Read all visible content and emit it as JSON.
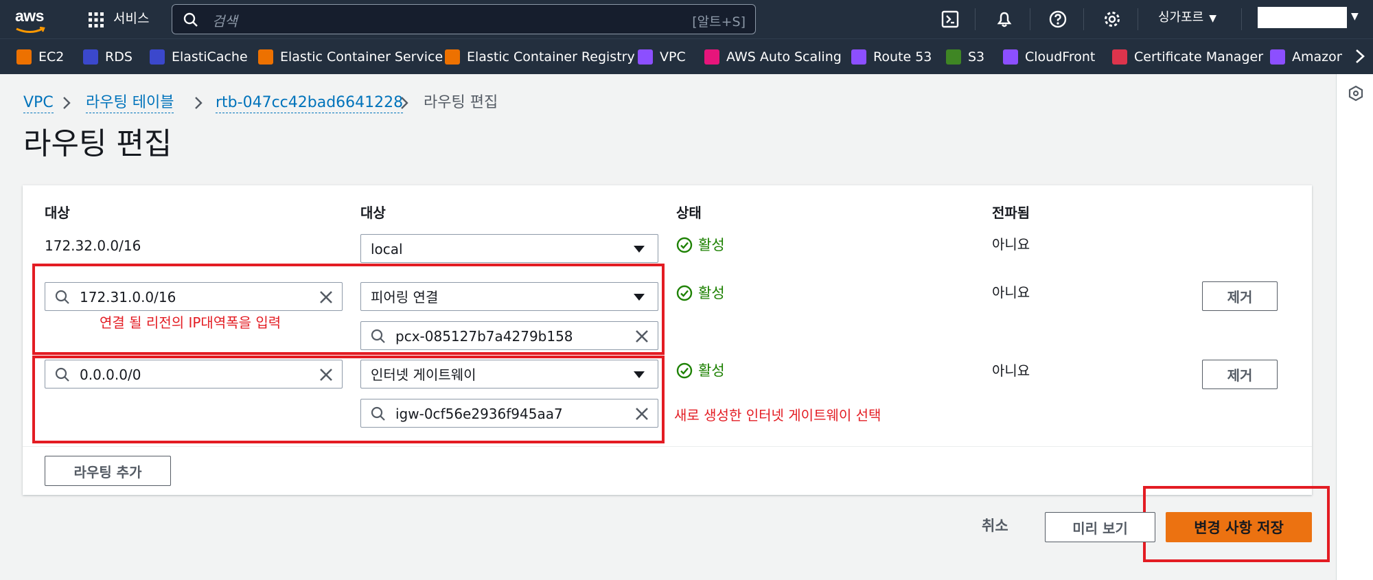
{
  "topnav": {
    "logo_text": "aws",
    "services_label": "서비스",
    "search_placeholder": "검색",
    "search_shortcut": "[알트+S]",
    "region_label": "싱가포르"
  },
  "favorites": [
    {
      "label": "EC2",
      "icon": "ec2-icon",
      "color": "#ed7100"
    },
    {
      "label": "RDS",
      "icon": "rds-icon",
      "color": "#3b48cc"
    },
    {
      "label": "ElastiCache",
      "icon": "elasticache-icon",
      "color": "#3b48cc"
    },
    {
      "label": "Elastic Container Service",
      "icon": "ecs-icon",
      "color": "#ed7100"
    },
    {
      "label": "Elastic Container Registry",
      "icon": "ecr-icon",
      "color": "#ed7100"
    },
    {
      "label": "VPC",
      "icon": "vpc-icon",
      "color": "#8c4fff"
    },
    {
      "label": "AWS Auto Scaling",
      "icon": "auto-scaling-icon",
      "color": "#e7157b"
    },
    {
      "label": "Route 53",
      "icon": "route53-icon",
      "color": "#8c4fff"
    },
    {
      "label": "S3",
      "icon": "s3-icon",
      "color": "#3f8624"
    },
    {
      "label": "CloudFront",
      "icon": "cloudfront-icon",
      "color": "#8c4fff"
    },
    {
      "label": "Certificate Manager",
      "icon": "certificate-manager-icon",
      "color": "#dd344c"
    },
    {
      "label": "Amazon C",
      "icon": "amazon-service-icon",
      "color": "#8c4fff"
    }
  ],
  "breadcrumb": {
    "items": [
      "VPC",
      "라우팅 테이블",
      "rtb-047cc42bad6641228"
    ],
    "current": "라우팅 편집"
  },
  "page_title": "라우팅 편집",
  "table": {
    "headers": [
      "대상",
      "대상",
      "상태",
      "전파됨"
    ],
    "rows": [
      {
        "destination": "172.32.0.0/16",
        "target_type": "local",
        "target_id": "",
        "status": "활성",
        "propagated": "아니요",
        "remove_label": ""
      },
      {
        "destination": "172.31.0.0/16",
        "target_type": "피어링 연결",
        "target_id": "pcx-085127b7a4279b158",
        "status": "활성",
        "propagated": "아니요",
        "remove_label": "제거"
      },
      {
        "destination": "0.0.0.0/0",
        "target_type": "인터넷 게이트웨이",
        "target_id": "igw-0cf56e2936f945aa7",
        "status": "활성",
        "propagated": "아니요",
        "remove_label": "제거"
      }
    ],
    "add_route_label": "라우팅 추가"
  },
  "annotations": {
    "cidr_note": "연결 될 리전의 IP대역폭을 입력",
    "igw_note": "새로 생성한 인터넷 게이트웨이 선택"
  },
  "footer": {
    "cancel_label": "취소",
    "preview_label": "미리 보기",
    "save_label": "변경 사항 저장"
  },
  "colors": {
    "nav_bg": "#232f3e",
    "link": "#0073bb",
    "success": "#1d8102",
    "primary": "#ec7211",
    "annotation": "#e31c23"
  }
}
